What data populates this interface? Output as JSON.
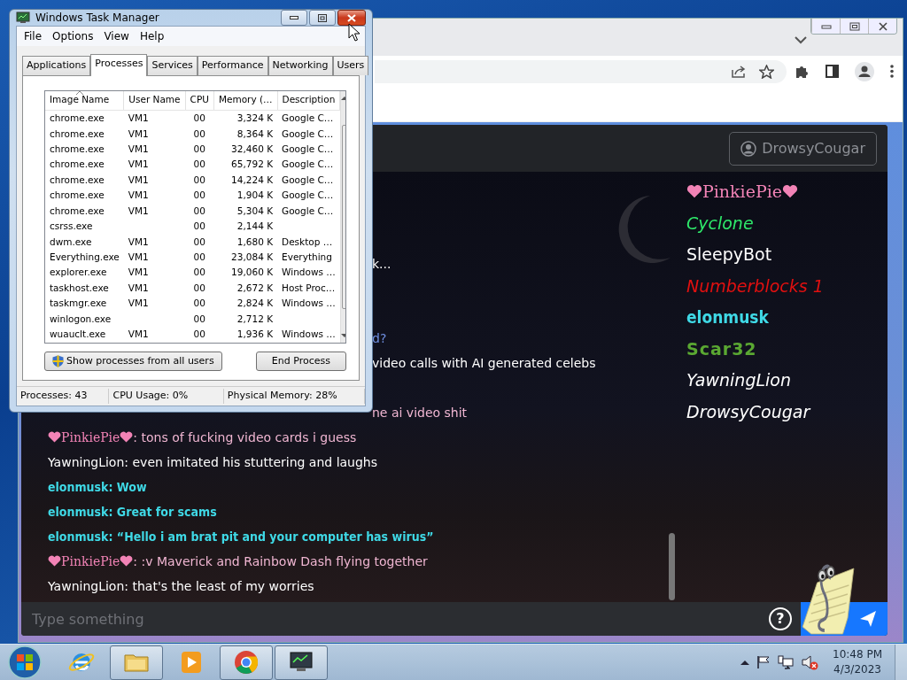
{
  "task_manager": {
    "title": "Windows Task Manager",
    "menu": [
      "File",
      "Options",
      "View",
      "Help"
    ],
    "tabs": [
      {
        "label": "Applications",
        "selected": false
      },
      {
        "label": "Processes",
        "selected": true
      },
      {
        "label": "Services",
        "selected": false
      },
      {
        "label": "Performance",
        "selected": false
      },
      {
        "label": "Networking",
        "selected": false
      },
      {
        "label": "Users",
        "selected": false
      }
    ],
    "columns": [
      {
        "label": "Image Name",
        "sorted": true
      },
      {
        "label": "User Name",
        "sorted": false
      },
      {
        "label": "CPU",
        "sorted": false
      },
      {
        "label": "Memory (…",
        "sorted": false
      },
      {
        "label": "Description",
        "sorted": false
      }
    ],
    "rows": [
      [
        "chrome.exe",
        "VM1",
        "00",
        "3,324 K",
        "Google C…"
      ],
      [
        "chrome.exe",
        "VM1",
        "00",
        "8,364 K",
        "Google C…"
      ],
      [
        "chrome.exe",
        "VM1",
        "00",
        "32,460 K",
        "Google C…"
      ],
      [
        "chrome.exe",
        "VM1",
        "00",
        "65,792 K",
        "Google C…"
      ],
      [
        "chrome.exe",
        "VM1",
        "00",
        "14,224 K",
        "Google C…"
      ],
      [
        "chrome.exe",
        "VM1",
        "00",
        "1,904 K",
        "Google C…"
      ],
      [
        "chrome.exe",
        "VM1",
        "00",
        "5,304 K",
        "Google C…"
      ],
      [
        "csrss.exe",
        "",
        "00",
        "2,144 K",
        ""
      ],
      [
        "dwm.exe",
        "VM1",
        "00",
        "1,680 K",
        "Desktop …"
      ],
      [
        "Everything.exe",
        "VM1",
        "00",
        "23,084 K",
        "Everything"
      ],
      [
        "explorer.exe",
        "VM1",
        "00",
        "19,060 K",
        "Windows …"
      ],
      [
        "taskhost.exe",
        "VM1",
        "00",
        "2,672 K",
        "Host Proc…"
      ],
      [
        "taskmgr.exe",
        "VM1",
        "00",
        "2,824 K",
        "Windows …"
      ],
      [
        "winlogon.exe",
        "",
        "00",
        "2,712 K",
        ""
      ],
      [
        "wuauclt.exe",
        "VM1",
        "00",
        "1,936 K",
        "Windows …"
      ]
    ],
    "show_all_button": "Show processes from all users",
    "end_button": "End Process",
    "status": [
      "Processes: 43",
      "CPU Usage: 0%",
      "Physical Memory: 28%"
    ]
  },
  "chat": {
    "profile_button": "DrowsyCougar",
    "partial_lines": [
      {
        "text": "k...",
        "color": "#ffffff"
      },
      {
        "text": "d?",
        "color": "#6f8fe0"
      },
      {
        "text": "video calls with AI generated celebs",
        "color": "#ffffff"
      },
      {
        "text": "ne ai video shit",
        "color": "#f0b6d2"
      }
    ],
    "messages": [
      {
        "kind": "hearts",
        "user": "PinkiePie",
        "text": ": tons of fucking video cards i guess",
        "color": "#f0b6d2"
      },
      {
        "kind": "plain",
        "user": "YawningLion",
        "text": ": even imitated his stuttering and laughs",
        "color": "#ffffff"
      },
      {
        "kind": "bold",
        "user": "elonmusk",
        "text": ": Wow",
        "color": "#3fd9e6"
      },
      {
        "kind": "bold",
        "user": "elonmusk",
        "text": ": Great for scams",
        "color": "#3fd9e6"
      },
      {
        "kind": "bold",
        "user": "elonmusk",
        "text": ": “Hello i am brat pit and your computer has wirus”",
        "color": "#3fd9e6"
      },
      {
        "kind": "hearts",
        "user": "PinkiePie",
        "text": ": :v Maverick and Rainbow Dash flying together",
        "color": "#f0b6d2"
      },
      {
        "kind": "plain",
        "user": "YawningLion",
        "text": ": that's the least of my worries",
        "color": "#ffffff"
      }
    ],
    "users": [
      {
        "kind": "hearts",
        "name": "PinkiePie",
        "color": "#f283b6"
      },
      {
        "kind": "italic",
        "name": "Cyclone",
        "color": "#2ee86a"
      },
      {
        "kind": "plain",
        "name": "SleepyBot",
        "color": "#ffffff"
      },
      {
        "kind": "italic",
        "name": "Numberblocks 1",
        "color": "#e01010"
      },
      {
        "kind": "bold",
        "name": "elonmusk",
        "color": "#3fd9e6"
      },
      {
        "kind": "heavy",
        "name": "Scar32",
        "color": "#5aa832"
      },
      {
        "kind": "italic",
        "name": "YawningLion",
        "color": "#ffffff"
      },
      {
        "kind": "italic",
        "name": "DrowsyCougar",
        "color": "#ffffff"
      }
    ],
    "input": {
      "placeholder": "Type something"
    },
    "help": "?"
  },
  "taskbar": {
    "apps": [
      {
        "kind": "ie",
        "running": false
      },
      {
        "kind": "folder",
        "running": true
      },
      {
        "kind": "media",
        "running": false
      },
      {
        "kind": "chrome",
        "running": true
      },
      {
        "kind": "monitor",
        "running": true
      }
    ],
    "time": "10:48 PM",
    "date": "4/3/2023"
  }
}
